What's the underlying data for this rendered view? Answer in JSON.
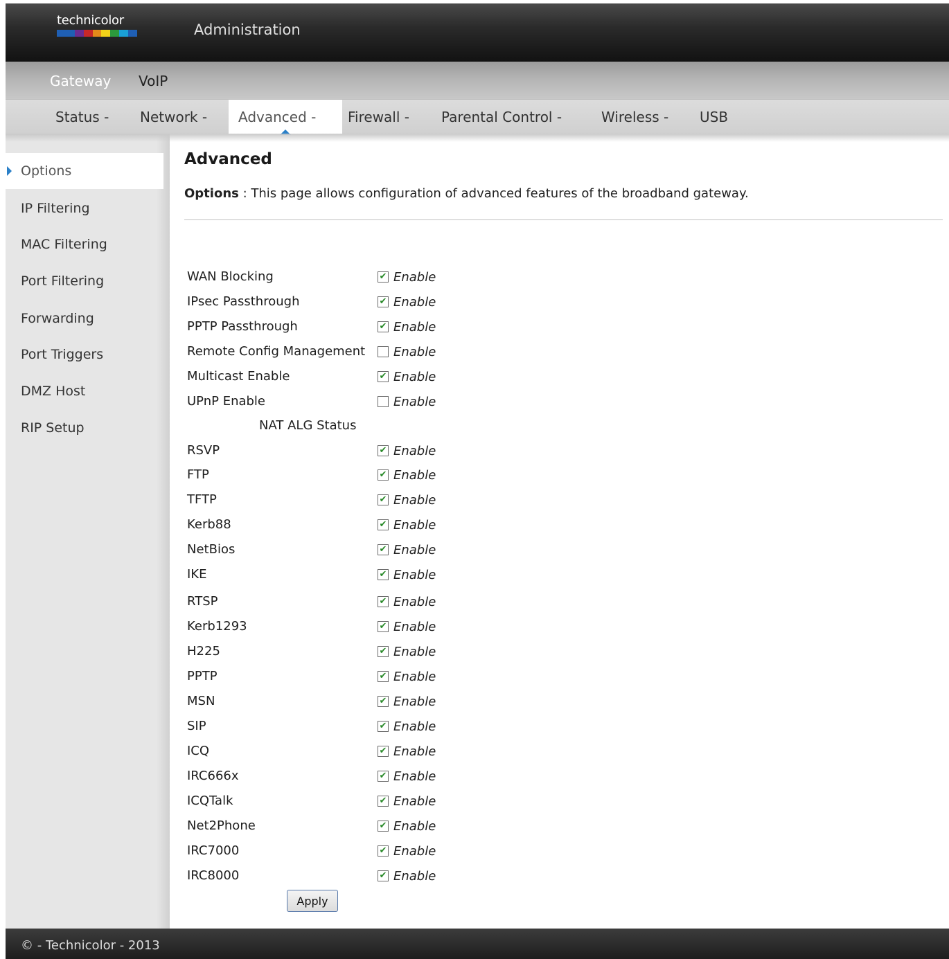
{
  "header": {
    "logo_text": "technicolor",
    "logo_colors": [
      "#1f5fb4",
      "#1f5fb4",
      "#6a2c91",
      "#c82828",
      "#e48a1a",
      "#f2d21a",
      "#2c9a3c",
      "#1aa0d6",
      "#1f5fb4"
    ],
    "title": "Administration"
  },
  "nav_primary": {
    "items": [
      {
        "label": "Gateway",
        "active": true
      },
      {
        "label": "VoIP",
        "active": false
      }
    ]
  },
  "nav_secondary": {
    "items": [
      {
        "label": "Status -",
        "active": false
      },
      {
        "label": "Network -",
        "active": false
      },
      {
        "label": "Advanced -",
        "active": true
      },
      {
        "label": "Firewall -",
        "active": false
      },
      {
        "label": "Parental Control -",
        "active": false
      },
      {
        "label": "Wireless -",
        "active": false
      },
      {
        "label": "USB",
        "active": false
      }
    ]
  },
  "sidebar": {
    "items": [
      {
        "label": "Options",
        "active": true
      },
      {
        "label": "IP Filtering",
        "active": false
      },
      {
        "label": "MAC Filtering",
        "active": false
      },
      {
        "label": "Port Filtering",
        "active": false
      },
      {
        "label": "Forwarding",
        "active": false
      },
      {
        "label": "Port Triggers",
        "active": false
      },
      {
        "label": "DMZ Host",
        "active": false
      },
      {
        "label": "RIP Setup",
        "active": false
      }
    ]
  },
  "main": {
    "title": "Advanced",
    "desc_bold": "Options",
    "desc_sep": " : ",
    "desc_text": "This page allows configuration of advanced features of the broadband gateway.",
    "enable_label": "Enable",
    "options": [
      {
        "label": "WAN Blocking",
        "checked": true
      },
      {
        "label": "IPsec Passthrough",
        "checked": true
      },
      {
        "label": "PPTP Passthrough",
        "checked": true
      },
      {
        "label": "Remote Config Management",
        "checked": false
      },
      {
        "label": "Multicast Enable",
        "checked": true
      },
      {
        "label": "UPnP Enable",
        "checked": false
      }
    ],
    "alg_heading": "NAT ALG Status",
    "alg_options": [
      {
        "label": "RSVP",
        "checked": true
      },
      {
        "label": "FTP",
        "checked": true
      },
      {
        "label": "TFTP",
        "checked": true
      },
      {
        "label": "Kerb88",
        "checked": true
      },
      {
        "label": "NetBios",
        "checked": true
      },
      {
        "label": "IKE",
        "checked": true
      },
      {
        "label": "RTSP",
        "checked": true
      },
      {
        "label": "Kerb1293",
        "checked": true
      },
      {
        "label": "H225",
        "checked": true
      },
      {
        "label": "PPTP",
        "checked": true
      },
      {
        "label": "MSN",
        "checked": true
      },
      {
        "label": "SIP",
        "checked": true
      },
      {
        "label": "ICQ",
        "checked": true
      },
      {
        "label": "IRC666x",
        "checked": true
      },
      {
        "label": "ICQTalk",
        "checked": true
      },
      {
        "label": "Net2Phone",
        "checked": true
      },
      {
        "label": "IRC7000",
        "checked": true
      },
      {
        "label": "IRC8000",
        "checked": true
      }
    ],
    "apply_label": "Apply"
  },
  "footer": {
    "text": "© - Technicolor - 2013"
  }
}
